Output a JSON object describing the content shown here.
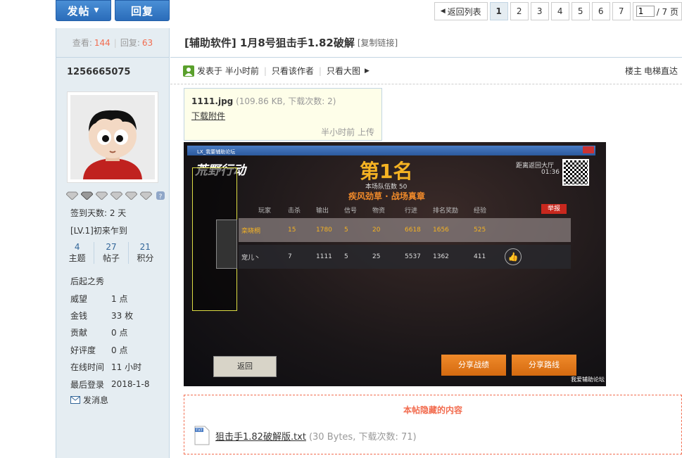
{
  "top": {
    "post_btn": "发帖",
    "reply_btn": "回复"
  },
  "pager": {
    "back": "返回列表",
    "pages": [
      "1",
      "2",
      "3",
      "4",
      "5",
      "6",
      "7"
    ],
    "current_input": "1",
    "total": "/ 7 页"
  },
  "stats": {
    "view_label": "查看:",
    "views": "144",
    "reply_label": "回复:",
    "replies": "63"
  },
  "user": {
    "name": "1256665075",
    "signin": "签到天数: 2 天",
    "level": "[LV.1]初来乍到",
    "counts": [
      {
        "value": "4",
        "label": "主题"
      },
      {
        "value": "27",
        "label": "帖子"
      },
      {
        "value": "21",
        "label": "积分"
      }
    ],
    "group": "后起之秀",
    "fields": [
      {
        "k": "威望",
        "v": "1 点"
      },
      {
        "k": "金钱",
        "v": "33 枚"
      },
      {
        "k": "贡献",
        "v": "0 点"
      },
      {
        "k": "好评度",
        "v": "0 点"
      },
      {
        "k": "在线时间",
        "v": "11 小时"
      },
      {
        "k": "最后登录",
        "v": "2018-1-8"
      }
    ],
    "send_msg": "发消息"
  },
  "post": {
    "title": "[辅助软件] 1月8号狙击手1.82破解",
    "copy_link": "[复制链接]",
    "posted": "发表于 半小时前",
    "author_only": "只看该作者",
    "big_img": "只看大图",
    "floor": "楼主",
    "elevator": "电梯直达"
  },
  "attachment_tip": {
    "file": "1111.jpg",
    "info": "(109.86 KB, 下载次数: 2)",
    "download": "下载附件",
    "uploaded": "半小时前 上传"
  },
  "game": {
    "window_title": "LX_我要辅助论坛",
    "logo": "荒野行动",
    "rank": "第1名",
    "team_count": "本场队伍数 50",
    "slogan": "疾风劲草 · 战场真章",
    "return_hall": "距离返回大厅",
    "timer": "01:36",
    "report": "举报",
    "headers": [
      "玩家",
      "击杀",
      "输出",
      "信号",
      "物资",
      "行进",
      "排名奖励",
      "经验"
    ],
    "rows": [
      [
        "栾晓桐",
        "15",
        "1780",
        "5",
        "20",
        "6618",
        "1656",
        "525"
      ],
      [
        "宠儿丶",
        "7",
        "1111",
        "5",
        "25",
        "5537",
        "1362",
        "411"
      ]
    ],
    "back_btn": "返回",
    "share_record": "分享战绩",
    "share_route": "分享路线",
    "watermark": "我爱辅助论坛"
  },
  "hidden": {
    "title": "本帖隐藏的内容",
    "file": "狙击手1.82破解版.txt",
    "info": "(30 Bytes, 下载次数: 71)"
  }
}
